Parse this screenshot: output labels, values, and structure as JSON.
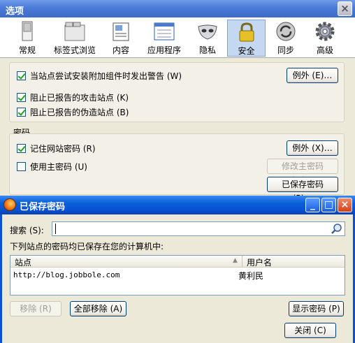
{
  "options_window": {
    "title": "选项",
    "close_glyph": "×",
    "tabs": [
      {
        "label": "常规",
        "icon": "general-icon"
      },
      {
        "label": "标签式浏览",
        "icon": "tabs-icon"
      },
      {
        "label": "内容",
        "icon": "content-icon"
      },
      {
        "label": "应用程序",
        "icon": "applications-icon"
      },
      {
        "label": "隐私",
        "icon": "privacy-mask-icon"
      },
      {
        "label": "安全",
        "icon": "security-lock-icon",
        "active": true
      },
      {
        "label": "同步",
        "icon": "sync-icon"
      },
      {
        "label": "高级",
        "icon": "advanced-gear-icon"
      }
    ],
    "security": {
      "warn_addons": {
        "label": "当站点尝试安装附加组件时发出警告 (W)",
        "checked": true
      },
      "exceptions_button": "例外 (E)…",
      "block_attack": {
        "label": "阻止已报告的攻击站点 (K)",
        "checked": true
      },
      "block_forgery": {
        "label": "阻止已报告的伪造站点 (B)",
        "checked": true
      }
    },
    "passwords": {
      "group_label": "密码",
      "remember": {
        "label": "记住网站密码 (R)",
        "checked": true
      },
      "exceptions_button": "例外 (X)…",
      "master": {
        "label": "使用主密码 (U)",
        "checked": false
      },
      "change_master_button": "修改主密码 (M)…",
      "saved_passwords_button": "已保存密码 (P)…"
    }
  },
  "saved_dialog": {
    "title": "已保存密码",
    "window_buttons": {
      "minimize": "_",
      "maximize": "□",
      "close": "×"
    },
    "search_label": "搜索 (S):",
    "search_value": "",
    "description": "下列站点的密码均已保存在您的计算机中:",
    "columns": [
      "站点",
      "用户名"
    ],
    "rows": [
      {
        "site": "http://blog.jobbole.com",
        "user": "黄利民"
      }
    ],
    "remove_button": "移除 (R)",
    "remove_all_button": "全部移除 (A)",
    "show_passwords_button": "显示密码 (P)",
    "close_button": "关闭 (C)"
  }
}
